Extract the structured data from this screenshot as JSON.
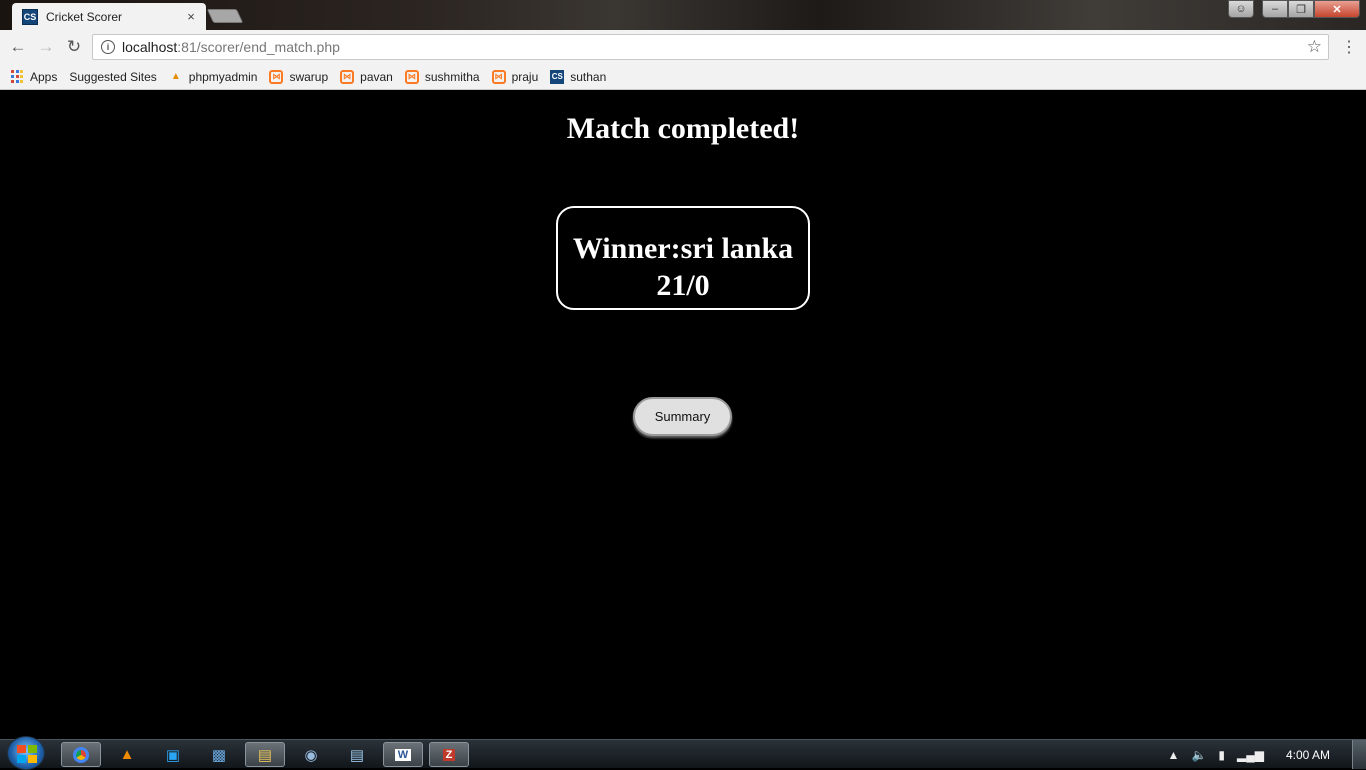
{
  "browser": {
    "tab_title": "Cricket Scorer",
    "tab_favicon": "CS",
    "tab_close": "×",
    "url_host": "localhost",
    "url_rest": ":81/scorer/end_match.php",
    "bookmarks": [
      {
        "label": "Apps",
        "icon": "apps-icon"
      },
      {
        "label": "Suggested Sites",
        "icon": "page-icon"
      },
      {
        "label": "phpmyadmin",
        "icon": "phpmyadmin-icon"
      },
      {
        "label": "swarup",
        "icon": "xampp-icon"
      },
      {
        "label": "pavan",
        "icon": "xampp-icon"
      },
      {
        "label": "sushmitha",
        "icon": "xampp-icon"
      },
      {
        "label": "praju",
        "icon": "xampp-icon"
      },
      {
        "label": "suthan",
        "icon": "cs-icon"
      }
    ]
  },
  "page": {
    "heading": "Match completed!",
    "winner_line": "Winner:sri lanka",
    "score_line": "21/0",
    "summary_button": "Summary"
  },
  "taskbar": {
    "clock": "4:00 AM",
    "apps": [
      "chrome-icon",
      "vlc-icon",
      "network-icon",
      "control-panel-icon",
      "explorer-icon",
      "paint-icon",
      "notepad-icon",
      "word-icon",
      "filezilla-icon"
    ]
  },
  "colors": {
    "page_background": "#000000",
    "text": "#ffffff",
    "button_background": "#e0e0e0"
  }
}
